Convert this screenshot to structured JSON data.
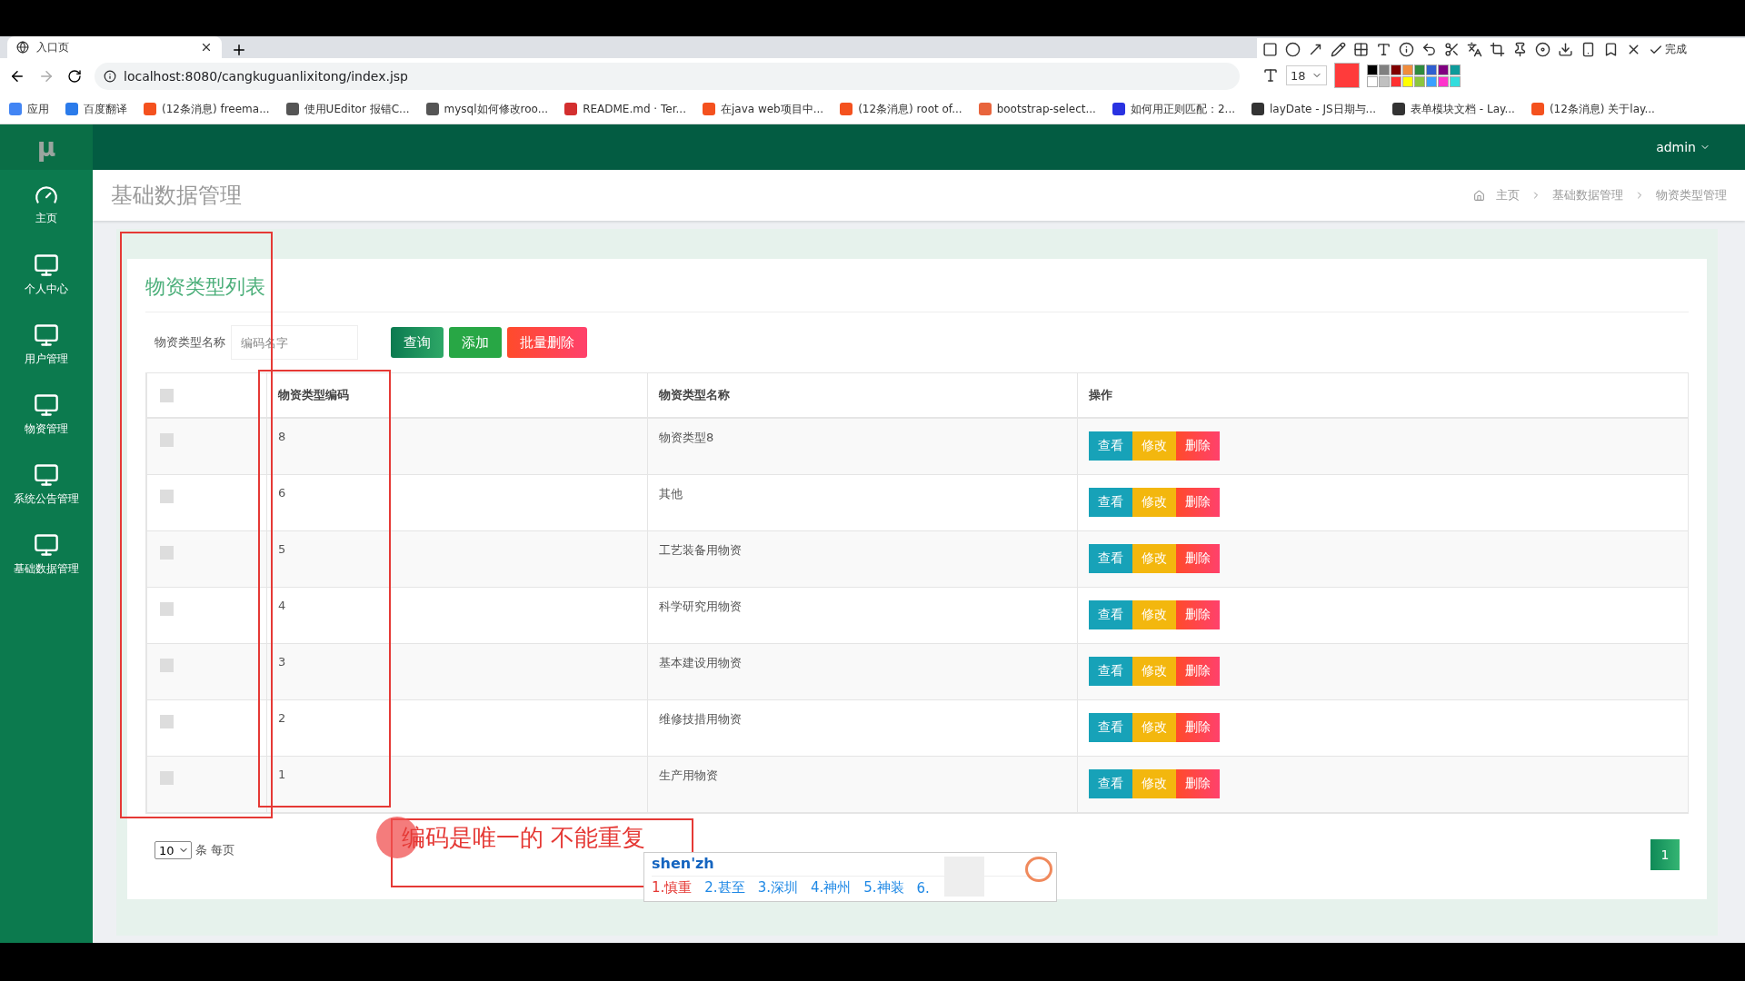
{
  "browser": {
    "tab_title": "入口页",
    "url": "localhost:8080/cangkuguanlixitong/index.jsp",
    "bookmarks": [
      {
        "label": "应用",
        "color": "#4285f4"
      },
      {
        "label": "百度翻译",
        "color": "#2b7bea"
      },
      {
        "label": "(12条消息) freema...",
        "color": "#f4511e"
      },
      {
        "label": "使用UEditor 报错C...",
        "color": "#555555"
      },
      {
        "label": "mysql如何修改roo...",
        "color": "#555555"
      },
      {
        "label": "README.md · Ter...",
        "color": "#d32f2f"
      },
      {
        "label": "在java web项目中...",
        "color": "#f4511e"
      },
      {
        "label": "(12条消息) root of...",
        "color": "#f4511e"
      },
      {
        "label": "bootstrap-select...",
        "color": "#e8643c"
      },
      {
        "label": "如何用正则匹配：2...",
        "color": "#2932e1"
      },
      {
        "label": "layDate - JS日期与...",
        "color": "#333333"
      },
      {
        "label": "表单模块文档 - Lay...",
        "color": "#333333"
      },
      {
        "label": "(12条消息) 关于lay...",
        "color": "#f4511e"
      }
    ]
  },
  "screenshot_tool": {
    "font_size": "18",
    "done": "完成",
    "palette": [
      {
        "color": "#000000"
      },
      {
        "color": "#808080"
      },
      {
        "color": "#800000"
      },
      {
        "color": "#f08c3c"
      },
      {
        "color": "#2e8b3e"
      },
      {
        "color": "#2f5fd0"
      },
      {
        "color": "#800080"
      },
      {
        "color": "#0e9a9a"
      },
      {
        "color": "#ffffff"
      },
      {
        "color": "#c0c0c0"
      },
      {
        "color": "#ff3030"
      },
      {
        "color": "#ffff00"
      },
      {
        "color": "#8cc63f"
      },
      {
        "color": "#3aa0ff"
      },
      {
        "color": "#ff33cc"
      },
      {
        "color": "#33dddd"
      }
    ]
  },
  "app": {
    "logo": "μ",
    "user": "admin",
    "sidebar": [
      {
        "label": "主页",
        "kind": "dashboard"
      },
      {
        "label": "个人中心",
        "kind": "monitor"
      },
      {
        "label": "用户管理",
        "kind": "monitor"
      },
      {
        "label": "物资管理",
        "kind": "monitor"
      },
      {
        "label": "系统公告管理",
        "kind": "monitor"
      },
      {
        "label": "基础数据管理",
        "kind": "monitor"
      }
    ],
    "page_title": "基础数据管理",
    "breadcrumb": [
      "主页",
      "基础数据管理",
      "物资类型管理"
    ],
    "card_title": "物资类型列表",
    "search": {
      "label": "物资类型名称",
      "placeholder": "编码名字"
    },
    "buttons": [
      {
        "label": "查询",
        "kind": "query"
      },
      {
        "label": "添加",
        "kind": "add"
      },
      {
        "label": "批量删除",
        "kind": "delete"
      }
    ],
    "table": {
      "select_all_checked": false,
      "columns": [
        "物资类型编码",
        "物资类型名称",
        "操作"
      ],
      "rows": [
        {
          "checked": false,
          "code": "8",
          "name": "物资类型8",
          "actions": [
            {
              "label": "查看",
              "kind": "view"
            },
            {
              "label": "修改",
              "kind": "edit"
            },
            {
              "label": "删除",
              "kind": "delete"
            }
          ]
        },
        {
          "checked": false,
          "code": "6",
          "name": "其他",
          "actions": [
            {
              "label": "查看",
              "kind": "view"
            },
            {
              "label": "修改",
              "kind": "edit"
            },
            {
              "label": "删除",
              "kind": "delete"
            }
          ]
        },
        {
          "checked": false,
          "code": "5",
          "name": "工艺装备用物资",
          "actions": [
            {
              "label": "查看",
              "kind": "view"
            },
            {
              "label": "修改",
              "kind": "edit"
            },
            {
              "label": "删除",
              "kind": "delete"
            }
          ]
        },
        {
          "checked": false,
          "code": "4",
          "name": "科学研究用物资",
          "actions": [
            {
              "label": "查看",
              "kind": "view"
            },
            {
              "label": "修改",
              "kind": "edit"
            },
            {
              "label": "删除",
              "kind": "delete"
            }
          ]
        },
        {
          "checked": false,
          "code": "3",
          "name": "基本建设用物资",
          "actions": [
            {
              "label": "查看",
              "kind": "view"
            },
            {
              "label": "修改",
              "kind": "edit"
            },
            {
              "label": "删除",
              "kind": "delete"
            }
          ]
        },
        {
          "checked": false,
          "code": "2",
          "name": "维修技措用物资",
          "actions": [
            {
              "label": "查看",
              "kind": "view"
            },
            {
              "label": "修改",
              "kind": "edit"
            },
            {
              "label": "删除",
              "kind": "delete"
            }
          ]
        },
        {
          "checked": false,
          "code": "1",
          "name": "生产用物资",
          "actions": [
            {
              "label": "查看",
              "kind": "view"
            },
            {
              "label": "修改",
              "kind": "edit"
            },
            {
              "label": "删除",
              "kind": "delete"
            }
          ]
        }
      ]
    },
    "page_size": "10",
    "page_size_label": "条 每页",
    "page": "1"
  },
  "annotation": {
    "text": "编码是唯一的 不能重复"
  },
  "ime": {
    "input": "shen'zh",
    "candidates": [
      {
        "label": "1.慎重",
        "selected": true
      },
      {
        "label": "2.甚至",
        "selected": false
      },
      {
        "label": "3.深圳",
        "selected": false
      },
      {
        "label": "4.神州",
        "selected": false
      },
      {
        "label": "5.神装",
        "selected": false
      },
      {
        "label": "6.",
        "selected": false
      }
    ]
  }
}
